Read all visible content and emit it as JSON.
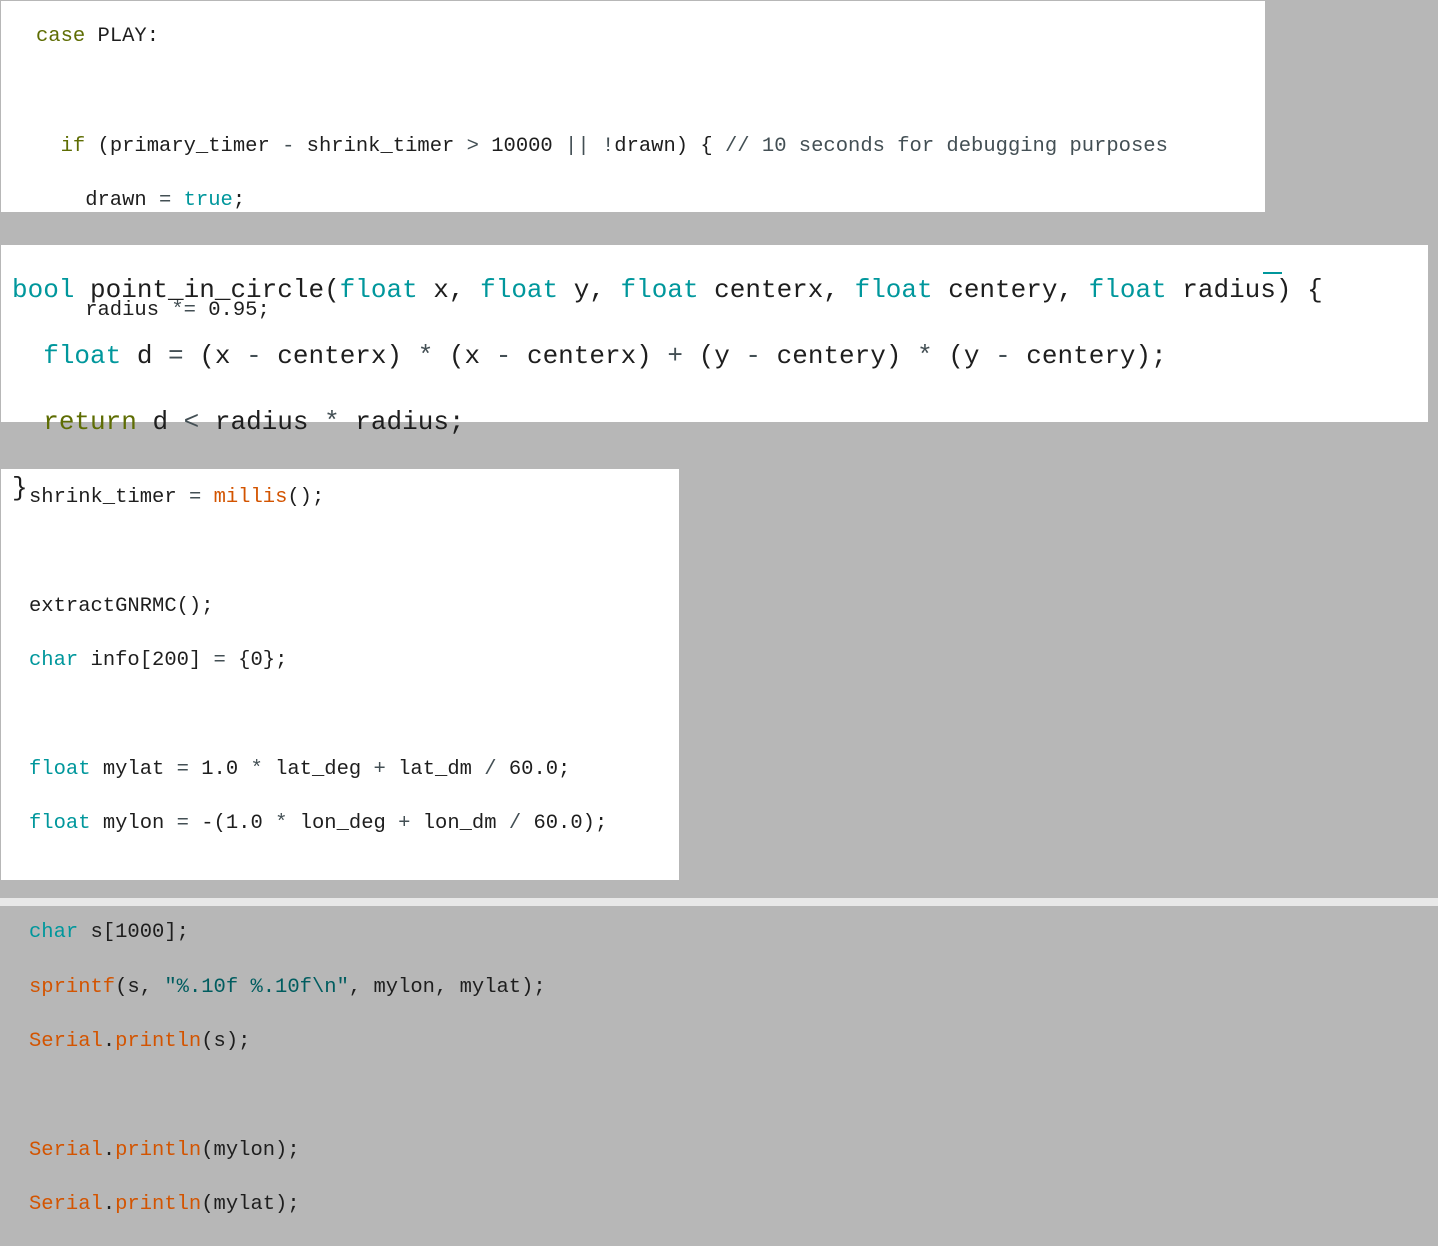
{
  "colors": {
    "background": "#b7b7b7",
    "panel": "#ffffff",
    "keyword_green": "#5e6d03",
    "keyword_teal": "#00979c",
    "function_orange": "#d35400",
    "string": "#005c5f",
    "comment": "#434f54",
    "text": "#1e1e1e"
  },
  "snippets": [
    {
      "lines": [
        [
          [
            "kw-green",
            "case"
          ],
          [
            "plain",
            " PLAY:"
          ]
        ],
        [],
        [
          [
            "plain",
            "  "
          ],
          [
            "kw-green",
            "if"
          ],
          [
            "plain",
            " (primary_timer "
          ],
          [
            "op",
            "-"
          ],
          [
            "plain",
            " shrink_timer "
          ],
          [
            "op",
            ">"
          ],
          [
            "plain",
            " 10000 "
          ],
          [
            "op",
            "||"
          ],
          [
            "plain",
            " "
          ],
          [
            "op",
            "!"
          ],
          [
            "plain",
            "drawn) { "
          ],
          [
            "cm",
            "// 10 seconds for debugging purposes"
          ]
        ],
        [
          [
            "plain",
            "    drawn "
          ],
          [
            "op",
            "="
          ],
          [
            "plain",
            " "
          ],
          [
            "kw-teal",
            "true"
          ],
          [
            "plain",
            ";"
          ]
        ],
        [],
        [
          [
            "plain",
            "    radius "
          ],
          [
            "op",
            "*="
          ],
          [
            "plain",
            " 0.95;"
          ]
        ]
      ]
    },
    {
      "lines": [
        [
          [
            "kw-teal",
            "bool"
          ],
          [
            "plain",
            " point_in_circle("
          ],
          [
            "kw-teal",
            "float"
          ],
          [
            "plain",
            " x, "
          ],
          [
            "kw-teal",
            "float"
          ],
          [
            "plain",
            " y, "
          ],
          [
            "kw-teal",
            "float"
          ],
          [
            "plain",
            " centerx, "
          ],
          [
            "kw-teal",
            "float"
          ],
          [
            "plain",
            " centery, "
          ],
          [
            "kw-teal",
            "float"
          ],
          [
            "plain",
            " radius) {"
          ]
        ],
        [
          [
            "plain",
            "  "
          ],
          [
            "kw-teal",
            "float"
          ],
          [
            "plain",
            " d "
          ],
          [
            "op",
            "="
          ],
          [
            "plain",
            " (x "
          ],
          [
            "op",
            "-"
          ],
          [
            "plain",
            " centerx) "
          ],
          [
            "op",
            "*"
          ],
          [
            "plain",
            " (x "
          ],
          [
            "op",
            "-"
          ],
          [
            "plain",
            " centerx) "
          ],
          [
            "op",
            "+"
          ],
          [
            "plain",
            " (y "
          ],
          [
            "op",
            "-"
          ],
          [
            "plain",
            " centery) "
          ],
          [
            "op",
            "*"
          ],
          [
            "plain",
            " (y "
          ],
          [
            "op",
            "-"
          ],
          [
            "plain",
            " centery);"
          ]
        ],
        [
          [
            "plain",
            "  "
          ],
          [
            "kw-green",
            "return"
          ],
          [
            "plain",
            " d "
          ],
          [
            "op",
            "<"
          ],
          [
            "plain",
            " radius "
          ],
          [
            "op",
            "*"
          ],
          [
            "plain",
            " radius;"
          ]
        ],
        [
          [
            "plain",
            "}"
          ]
        ]
      ]
    },
    {
      "lines": [
        [
          [
            "plain",
            "shrink_timer "
          ],
          [
            "op",
            "="
          ],
          [
            "plain",
            " "
          ],
          [
            "fn",
            "millis"
          ],
          [
            "plain",
            "();"
          ]
        ],
        [],
        [
          [
            "plain",
            "extractGNRMC();"
          ]
        ],
        [
          [
            "kw-teal",
            "char"
          ],
          [
            "plain",
            " info[200] "
          ],
          [
            "op",
            "="
          ],
          [
            "plain",
            " {0};"
          ]
        ],
        [],
        [
          [
            "kw-teal",
            "float"
          ],
          [
            "plain",
            " mylat "
          ],
          [
            "op",
            "="
          ],
          [
            "plain",
            " 1.0 "
          ],
          [
            "op",
            "*"
          ],
          [
            "plain",
            " lat_deg "
          ],
          [
            "op",
            "+"
          ],
          [
            "plain",
            " lat_dm "
          ],
          [
            "op",
            "/"
          ],
          [
            "plain",
            " 60.0;"
          ]
        ],
        [
          [
            "kw-teal",
            "float"
          ],
          [
            "plain",
            " mylon "
          ],
          [
            "op",
            "="
          ],
          [
            "plain",
            " -(1.0 "
          ],
          [
            "op",
            "*"
          ],
          [
            "plain",
            " lon_deg "
          ],
          [
            "op",
            "+"
          ],
          [
            "plain",
            " lon_dm "
          ],
          [
            "op",
            "/"
          ],
          [
            "plain",
            " 60.0);"
          ]
        ],
        [],
        [
          [
            "kw-teal",
            "char"
          ],
          [
            "plain",
            " s[1000];"
          ]
        ],
        [
          [
            "fn",
            "sprintf"
          ],
          [
            "plain",
            "(s, "
          ],
          [
            "str",
            "\"%.10f %.10f\\n\""
          ],
          [
            "plain",
            ", mylon, mylat);"
          ]
        ],
        [
          [
            "fn",
            "Serial"
          ],
          [
            "plain",
            "."
          ],
          [
            "fn",
            "println"
          ],
          [
            "plain",
            "(s);"
          ]
        ],
        [],
        [
          [
            "fn",
            "Serial"
          ],
          [
            "plain",
            "."
          ],
          [
            "fn",
            "println"
          ],
          [
            "plain",
            "(mylon);"
          ]
        ],
        [
          [
            "fn",
            "Serial"
          ],
          [
            "plain",
            "."
          ],
          [
            "fn",
            "println"
          ],
          [
            "plain",
            "(mylat);"
          ]
        ]
      ]
    }
  ]
}
